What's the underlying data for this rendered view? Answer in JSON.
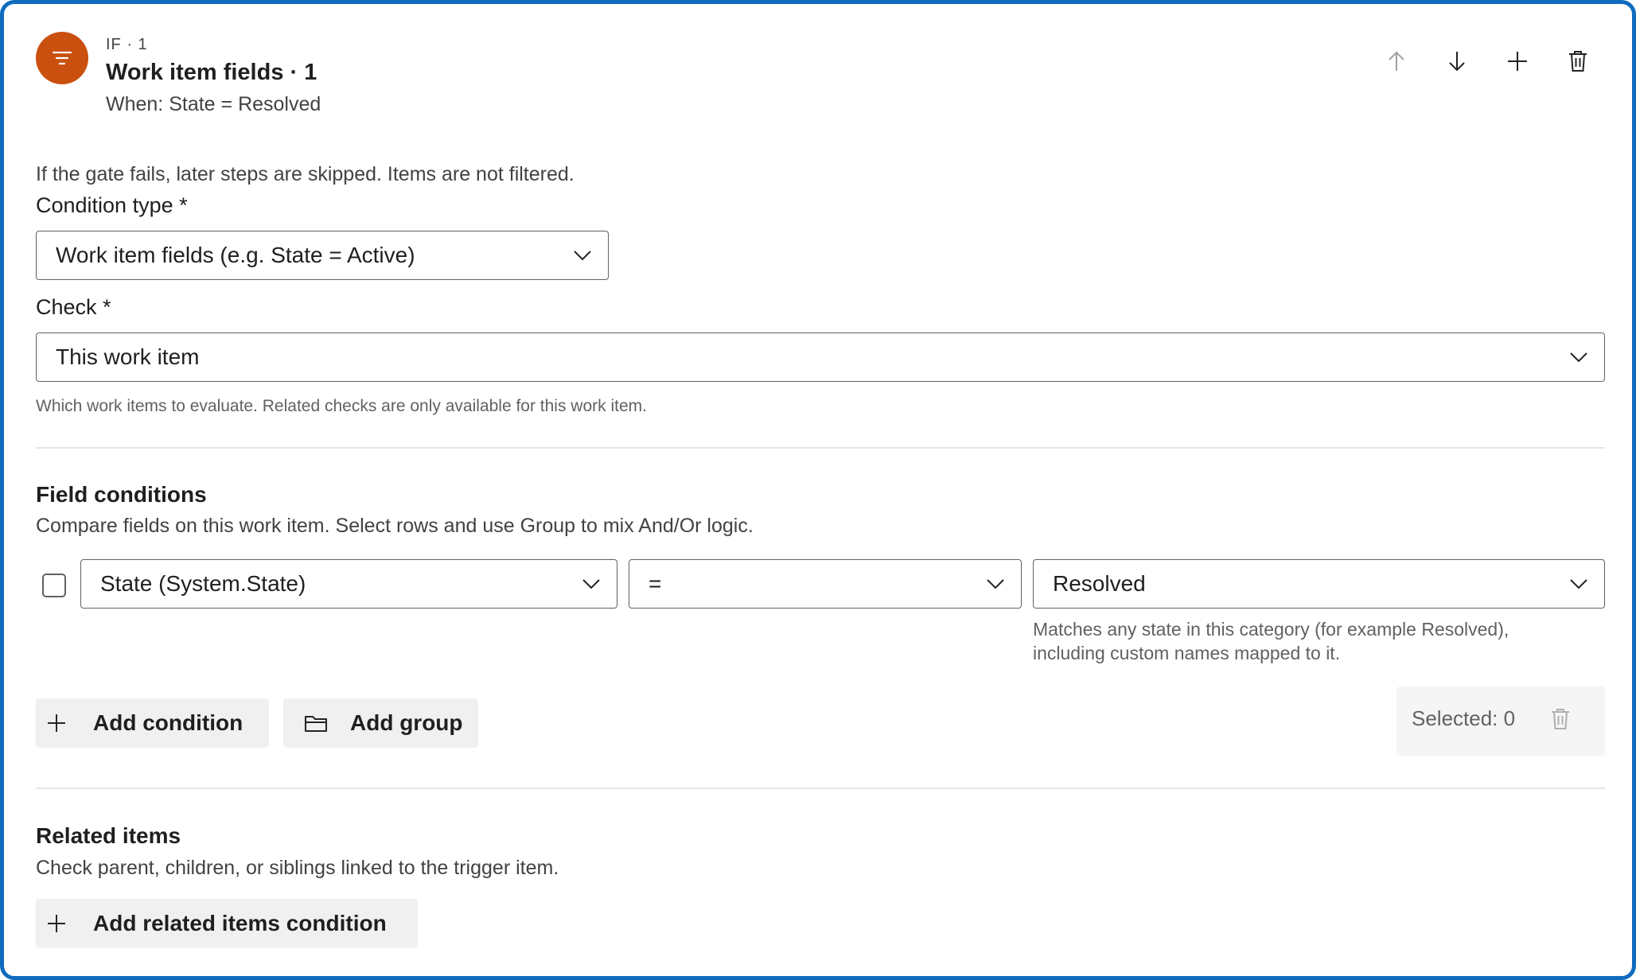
{
  "header": {
    "eyebrow": "IF · 1",
    "title": "Work item fields · 1",
    "subtitle": "When: State = Resolved",
    "icon": "filter-icon",
    "icon_color": "#ca5010",
    "actions": [
      {
        "name": "move-up-button",
        "icon": "arrow-up-icon",
        "disabled": true
      },
      {
        "name": "move-down-button",
        "icon": "arrow-down-icon"
      },
      {
        "name": "add-step-button",
        "icon": "plus-icon"
      },
      {
        "name": "delete-step-button",
        "icon": "trash-icon"
      }
    ]
  },
  "gate_note": "If the gate fails, later steps are skipped. Items are not filtered.",
  "condition_type": {
    "label": "Condition type *",
    "value": "Work item fields (e.g. State = Active)"
  },
  "check": {
    "label": "Check *",
    "value": "This work item",
    "hint": "Which work items to evaluate. Related checks are only available for this work item."
  },
  "field_conditions": {
    "title": "Field conditions",
    "description": "Compare fields on this work item. Select rows and use Group to mix And/Or logic.",
    "row": {
      "checked": false,
      "field": "State (System.State)",
      "operator": "=",
      "value": "Resolved",
      "value_hint_line1": "Matches any state in this category (for example Resolved),",
      "value_hint_line2": "including custom names mapped to it."
    },
    "add_condition_label": "Add condition",
    "add_group_label": "Add group",
    "selected_label": "Selected: 0"
  },
  "related_items": {
    "title": "Related items",
    "description": "Check parent, children, or siblings linked to the trigger item.",
    "add_label": "Add related items condition"
  },
  "colors": {
    "accent_border": "#0f6cbd",
    "step_icon": "#ca5010",
    "button_bg": "#f0f0f0"
  }
}
